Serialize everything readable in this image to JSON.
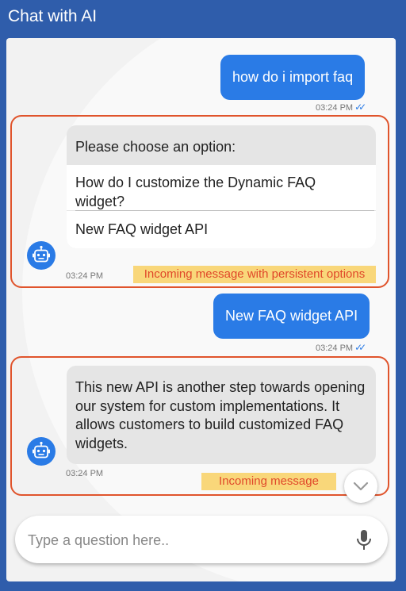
{
  "header": {
    "title": "Chat with AI"
  },
  "messages": [
    {
      "direction": "outgoing",
      "text": "how do i import faq",
      "time": "03:24 PM",
      "status": "read"
    },
    {
      "direction": "incoming",
      "prompt": "Please choose an option:",
      "options": [
        "How do I customize the Dynamic FAQ widget?",
        "New FAQ widget API"
      ],
      "time": "03:24 PM",
      "note": "Incoming message with persistent options"
    },
    {
      "direction": "outgoing",
      "text": "New FAQ widget API",
      "time": "03:24 PM",
      "status": "read"
    },
    {
      "direction": "incoming",
      "text": "This new API is another step towards opening our system for custom implementations. It allows customers to build customized FAQ widgets.",
      "time": "03:24 PM",
      "note": "Incoming message"
    }
  ],
  "composer": {
    "placeholder": "Type a question here..",
    "value": ""
  },
  "icons": {
    "bot_avatar": "robot-icon",
    "read_receipt": "double-check-icon",
    "scroll_down": "chevron-down-icon",
    "mic": "microphone-icon"
  },
  "colors": {
    "header": "#2f5dab",
    "outgoing_bubble": "#2a7be6",
    "incoming_bubble": "#e5e5e5",
    "annotation_border": "#e0542c",
    "annotation_fill": "#f9d77a",
    "annotation_text": "#e0482a"
  }
}
